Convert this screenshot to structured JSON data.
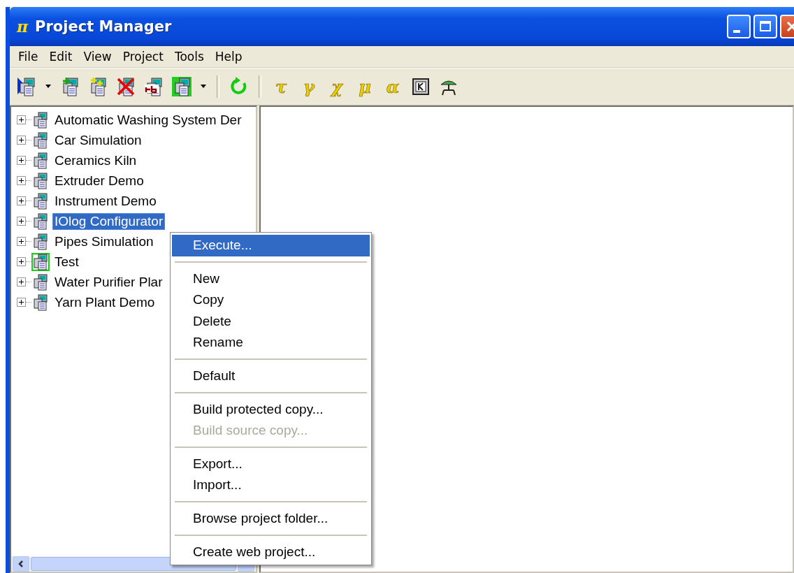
{
  "window": {
    "title": "Project Manager",
    "title_icon": "π"
  },
  "menu_bar": [
    "File",
    "Edit",
    "View",
    "Project",
    "Tools",
    "Help"
  ],
  "toolbar": [
    {
      "kind": "icon"
    },
    {
      "kind": "dropdown"
    },
    {
      "kind": "icon"
    },
    {
      "kind": "icon"
    },
    {
      "kind": "icon"
    },
    {
      "kind": "icon"
    },
    {
      "kind": "icon"
    },
    {
      "kind": "dropdown"
    },
    {
      "kind": "separator"
    },
    {
      "kind": "icon"
    },
    {
      "kind": "separator"
    },
    {
      "kind": "glyph",
      "text": "τ"
    },
    {
      "kind": "glyph",
      "text": "γ"
    },
    {
      "kind": "glyph",
      "text": "χ"
    },
    {
      "kind": "glyph",
      "text": "μ"
    },
    {
      "kind": "glyph",
      "text": "α"
    },
    {
      "kind": "icon"
    },
    {
      "kind": "icon"
    }
  ],
  "tree": [
    {
      "label": "Automatic Washing System Der",
      "selected": false,
      "default": false
    },
    {
      "label": "Car Simulation",
      "selected": false,
      "default": false
    },
    {
      "label": "Ceramics Kiln",
      "selected": false,
      "default": false
    },
    {
      "label": "Extruder Demo",
      "selected": false,
      "default": false
    },
    {
      "label": "Instrument Demo",
      "selected": false,
      "default": false
    },
    {
      "label": "IOlog Configurator",
      "selected": true,
      "default": false
    },
    {
      "label": "Pipes Simulation",
      "selected": false,
      "default": false
    },
    {
      "label": "Test",
      "selected": false,
      "default": true
    },
    {
      "label": "Water Purifier Plar",
      "selected": false,
      "default": false
    },
    {
      "label": "Yarn Plant Demo",
      "selected": false,
      "default": false
    }
  ],
  "context_menu": [
    {
      "kind": "item",
      "label": "Execute...",
      "selected": true,
      "disabled": false
    },
    {
      "kind": "separator"
    },
    {
      "kind": "item",
      "label": "New",
      "selected": false,
      "disabled": false
    },
    {
      "kind": "item",
      "label": "Copy",
      "selected": false,
      "disabled": false
    },
    {
      "kind": "item",
      "label": "Delete",
      "selected": false,
      "disabled": false
    },
    {
      "kind": "item",
      "label": "Rename",
      "selected": false,
      "disabled": false
    },
    {
      "kind": "separator"
    },
    {
      "kind": "item",
      "label": "Default",
      "selected": false,
      "disabled": false
    },
    {
      "kind": "separator"
    },
    {
      "kind": "item",
      "label": "Build protected copy...",
      "selected": false,
      "disabled": false
    },
    {
      "kind": "item",
      "label": "Build source copy...",
      "selected": false,
      "disabled": true
    },
    {
      "kind": "separator"
    },
    {
      "kind": "item",
      "label": "Export...",
      "selected": false,
      "disabled": false
    },
    {
      "kind": "item",
      "label": "Import...",
      "selected": false,
      "disabled": false
    },
    {
      "kind": "separator"
    },
    {
      "kind": "item",
      "label": "Browse project folder...",
      "selected": false,
      "disabled": false
    },
    {
      "kind": "separator"
    },
    {
      "kind": "item",
      "label": "Create web project...",
      "selected": false,
      "disabled": false
    }
  ]
}
